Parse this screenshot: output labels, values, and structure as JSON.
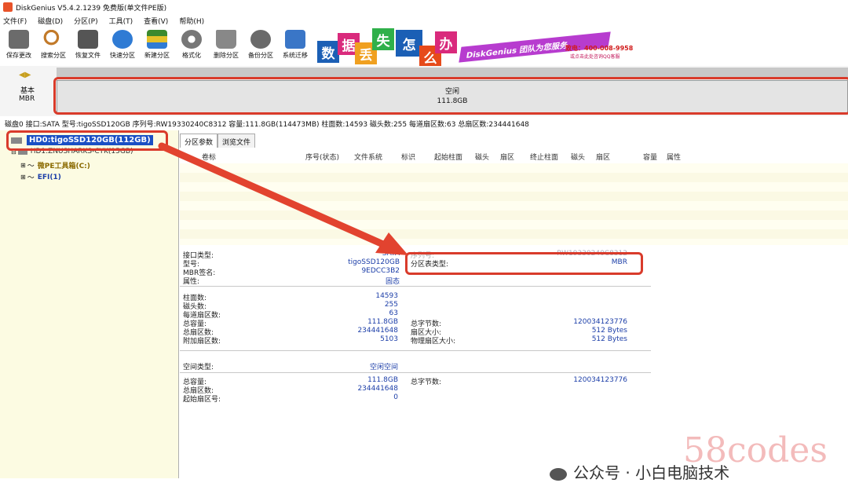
{
  "window": {
    "title": "DiskGenius V5.4.2.1239 免费版(单文件PE版)"
  },
  "menu": [
    "文件(F)",
    "磁盘(D)",
    "分区(P)",
    "工具(T)",
    "查看(V)",
    "帮助(H)"
  ],
  "toolbar": [
    {
      "label": "保存更改",
      "icon": "save-icon",
      "color": "#6b6b6b"
    },
    {
      "label": "搜索分区",
      "icon": "magnifier-icon",
      "color": "#c27a2a"
    },
    {
      "label": "恢复文件",
      "icon": "disk-recover-icon",
      "color": "#555555"
    },
    {
      "label": "快速分区",
      "icon": "quick-partition-icon",
      "color": "#2f7bd4"
    },
    {
      "label": "新建分区",
      "icon": "new-partition-icon",
      "color": "#3b8a2e"
    },
    {
      "label": "格式化",
      "icon": "format-icon",
      "color": "#777777"
    },
    {
      "label": "删除分区",
      "icon": "trash-icon",
      "color": "#888888"
    },
    {
      "label": "备份分区",
      "icon": "backup-icon",
      "color": "#6a6a6a"
    },
    {
      "label": "系统迁移",
      "icon": "migrate-icon",
      "color": "#3a76c7"
    }
  ],
  "banner": {
    "tiles": [
      "数",
      "据",
      "丢",
      "失",
      "怎",
      "么",
      "办"
    ],
    "tile_colors": [
      "#1b5fb5",
      "#d92a7c",
      "#f0a020",
      "#2fb04a",
      "#1b5fb5",
      "#e64a1a",
      "#d92a7c"
    ],
    "slogan": "DiskGenius 团队为您服务",
    "phone": "致电：400-008-9958",
    "qq": "或点击此处咨询QQ客服"
  },
  "diskmap": {
    "type_label_1": "基本",
    "type_label_2": "MBR",
    "free_label": "空闲",
    "free_size": "111.8GB"
  },
  "infobar": "磁盘0 接口:SATA  型号:tigoSSD120GB  序列号:RW19330240C8312  容量:111.8GB(114473MB)  柱面数:14593  磁头数:255  每道扇区数:63  总扇区数:234441648",
  "tree": {
    "disk0": "HD0:tigoSSD120GB(112GB)",
    "disk1": "HD1:ZNUSHARKS-CYK(15GB)",
    "part1": "微PE工具箱(C:)",
    "part2": "EFI(1)"
  },
  "tabs": [
    "分区参数",
    "浏览文件"
  ],
  "columns": [
    "卷标",
    "序号(状态)",
    "文件系统",
    "标识",
    "起始柱面",
    "磁头",
    "扇区",
    "终止柱面",
    "磁头",
    "扇区",
    "容量",
    "属性"
  ],
  "details": {
    "interface_type_label": "接口类型:",
    "interface_type_value": "SATA",
    "model_label": "型号:",
    "model_value": "tigoSSD120GB",
    "mbr_sig_label": "MBR签名:",
    "mbr_sig_value": "9EDCC3B2",
    "attr_label": "属性:",
    "attr_value": "固态",
    "serial_label": "序列号:",
    "serial_value": "RW19330240C8312",
    "pt_type_label": "分区表类型:",
    "pt_type_value": "MBR",
    "cyl_label": "柱面数:",
    "cyl_value": "14593",
    "heads_label": "磁头数:",
    "heads_value": "255",
    "spt_label": "每道扇区数:",
    "spt_value": "63",
    "cap_label": "总容量:",
    "cap_value": "111.8GB",
    "total_sec_label": "总扇区数:",
    "total_sec_value": "234441648",
    "extra_sec_label": "附加扇区数:",
    "extra_sec_value": "5103",
    "total_bytes_label": "总字节数:",
    "total_bytes_value": "120034123776",
    "sec_size_label": "扇区大小:",
    "sec_size_value": "512 Bytes",
    "phys_sec_label": "物理扇区大小:",
    "phys_sec_value": "512 Bytes",
    "space_type_label": "空间类型:",
    "space_type_value": "空闲空间",
    "cap2_label": "总容量:",
    "cap2_value": "111.8GB",
    "total_sec2_label": "总扇区数:",
    "total_sec2_value": "234441648",
    "start_sec_label": "起始扇区号:",
    "start_sec_value": "0",
    "total_bytes2_label": "总字节数:",
    "total_bytes2_value": "120034123776"
  },
  "watermark": "公众号 · 小白电脑技术",
  "watermark2": "58codes",
  "accent_color": "#d93b2b"
}
